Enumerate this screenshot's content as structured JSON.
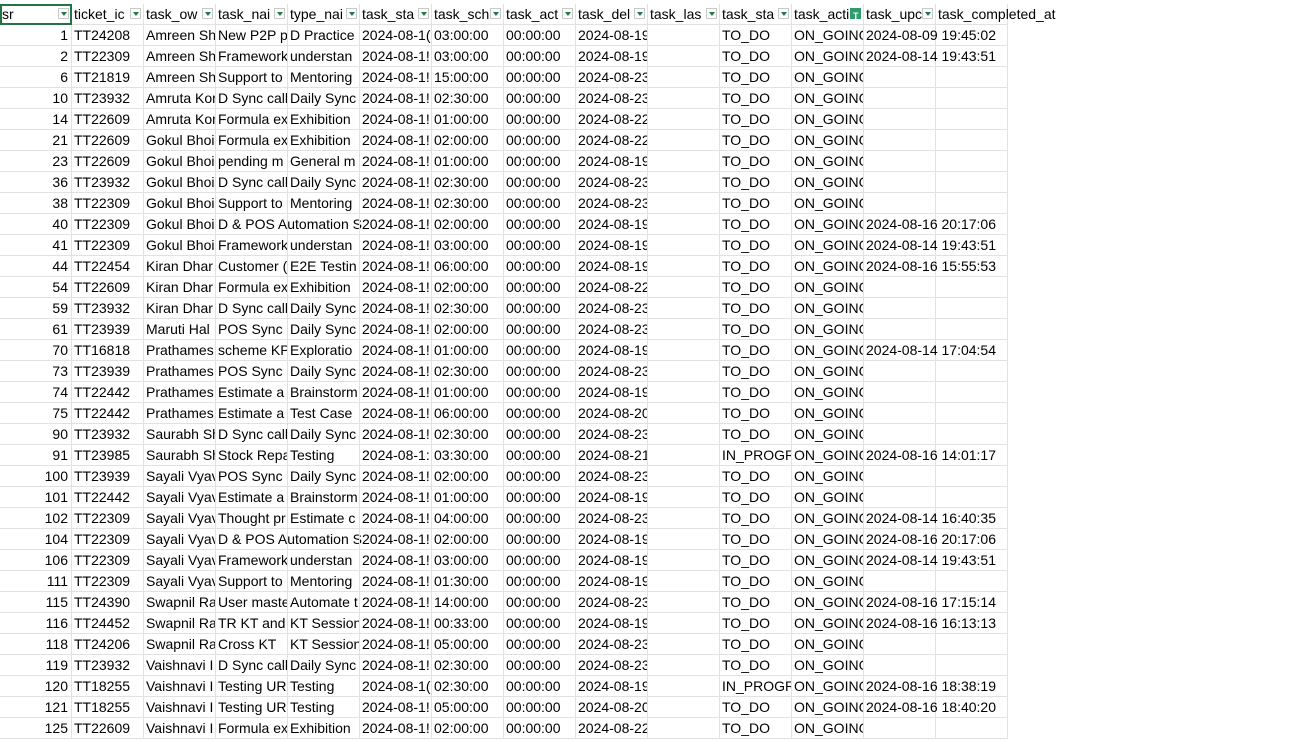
{
  "headers": [
    "sr",
    "ticket_id",
    "task_owner",
    "task_name",
    "type_name",
    "task_start",
    "task_sch",
    "task_act",
    "task_deadline",
    "task_last",
    "task_status",
    "task_activity",
    "task_updated",
    "task_completed_at"
  ],
  "header_display": [
    "sr",
    "ticket_ic",
    "task_ow",
    "task_nai",
    "type_nai",
    "task_sta",
    "task_sch",
    "task_act",
    "task_del",
    "task_las",
    "task_sta",
    "task_acti",
    "task_upc",
    "task_completed_at"
  ],
  "rows": [
    [
      "1",
      "TT24208",
      "Amreen Sh",
      "New P2P p",
      "D Practice",
      "2024-08-1(",
      "03:00:00",
      "00:00:00",
      "2024-08-19",
      "",
      "TO_DO",
      "ON_GOING",
      "2024-08-09 19:45:02",
      ""
    ],
    [
      "2",
      "TT22309",
      "Amreen Sh",
      "Framework",
      "understan",
      "2024-08-1!",
      "03:00:00",
      "00:00:00",
      "2024-08-19",
      "",
      "TO_DO",
      "ON_GOING",
      "2024-08-14 19:43:51",
      ""
    ],
    [
      "6",
      "TT21819",
      "Amreen Sh",
      "Support to",
      "Mentoring",
      "2024-08-1!",
      "15:00:00",
      "00:00:00",
      "2024-08-23",
      "",
      "TO_DO",
      "ON_GOING",
      "",
      ""
    ],
    [
      "10",
      "TT23932",
      "Amruta Kor",
      "D Sync call",
      "Daily Sync",
      "2024-08-1!",
      "02:30:00",
      "00:00:00",
      "2024-08-23",
      "",
      "TO_DO",
      "ON_GOING",
      "",
      ""
    ],
    [
      "14",
      "TT22609",
      "Amruta Kor",
      "Formula ex",
      "Exhibition",
      "2024-08-1!",
      "01:00:00",
      "00:00:00",
      "2024-08-22",
      "",
      "TO_DO",
      "ON_GOING",
      "",
      ""
    ],
    [
      "21",
      "TT22609",
      "Gokul Bhoi",
      "Formula ex",
      "Exhibition",
      "2024-08-1!",
      "02:00:00",
      "00:00:00",
      "2024-08-22",
      "",
      "TO_DO",
      "ON_GOING",
      "",
      ""
    ],
    [
      "23",
      "TT22609",
      "Gokul Bhoi",
      "pending m",
      "General m",
      "2024-08-1!",
      "01:00:00",
      "00:00:00",
      "2024-08-19",
      "",
      "TO_DO",
      "ON_GOING",
      "",
      ""
    ],
    [
      "36",
      "TT23932",
      "Gokul Bhoi",
      "D Sync call",
      "Daily Sync",
      "2024-08-1!",
      "02:30:00",
      "00:00:00",
      "2024-08-23",
      "",
      "TO_DO",
      "ON_GOING",
      "",
      ""
    ],
    [
      "38",
      "TT22309",
      "Gokul Bhoi",
      "Support to",
      "Mentoring",
      "2024-08-1!",
      "02:30:00",
      "00:00:00",
      "2024-08-23",
      "",
      "TO_DO",
      "ON_GOING",
      "",
      ""
    ],
    [
      "40",
      "TT22309",
      "Gokul Bhoi",
      "D & POS Automation S",
      "",
      "2024-08-1!",
      "02:00:00",
      "00:00:00",
      "2024-08-19",
      "",
      "TO_DO",
      "ON_GOING",
      "2024-08-16 20:17:06",
      ""
    ],
    [
      "41",
      "TT22309",
      "Gokul Bhoi",
      "Framework",
      "understan",
      "2024-08-1!",
      "03:00:00",
      "00:00:00",
      "2024-08-19",
      "",
      "TO_DO",
      "ON_GOING",
      "2024-08-14 19:43:51",
      ""
    ],
    [
      "44",
      "TT22454",
      "Kiran Dhar",
      "Customer (",
      "E2E Testin",
      "2024-08-1!",
      "06:00:00",
      "00:00:00",
      "2024-08-19",
      "",
      "TO_DO",
      "ON_GOING",
      "2024-08-16 15:55:53",
      ""
    ],
    [
      "54",
      "TT22609",
      "Kiran Dhar",
      "Formula ex",
      "Exhibition",
      "2024-08-1!",
      "02:00:00",
      "00:00:00",
      "2024-08-22",
      "",
      "TO_DO",
      "ON_GOING",
      "",
      ""
    ],
    [
      "59",
      "TT23932",
      "Kiran Dhar",
      "D Sync call",
      "Daily Sync",
      "2024-08-1!",
      "02:30:00",
      "00:00:00",
      "2024-08-23",
      "",
      "TO_DO",
      "ON_GOING",
      "",
      ""
    ],
    [
      "61",
      "TT23939",
      "Maruti Hal",
      "POS Sync C",
      "Daily Sync",
      "2024-08-1!",
      "02:00:00",
      "00:00:00",
      "2024-08-23",
      "",
      "TO_DO",
      "ON_GOING",
      "",
      ""
    ],
    [
      "70",
      "TT16818",
      "Prathames",
      "scheme KP",
      "Exploratio",
      "2024-08-1!",
      "01:00:00",
      "00:00:00",
      "2024-08-19",
      "",
      "TO_DO",
      "ON_GOING",
      "2024-08-14 17:04:54",
      ""
    ],
    [
      "73",
      "TT23939",
      "Prathames",
      "POS Sync C",
      "Daily Sync",
      "2024-08-1!",
      "02:30:00",
      "00:00:00",
      "2024-08-23",
      "",
      "TO_DO",
      "ON_GOING",
      "",
      ""
    ],
    [
      "74",
      "TT22442",
      "Prathames",
      "Estimate a",
      "Brainstorm",
      "2024-08-1!",
      "01:00:00",
      "00:00:00",
      "2024-08-19",
      "",
      "TO_DO",
      "ON_GOING",
      "",
      ""
    ],
    [
      "75",
      "TT22442",
      "Prathames",
      "Estimate a",
      "Test Case",
      "2024-08-1!",
      "06:00:00",
      "00:00:00",
      "2024-08-20",
      "",
      "TO_DO",
      "ON_GOING",
      "",
      ""
    ],
    [
      "90",
      "TT23932",
      "Saurabh Sh",
      "D Sync call",
      "Daily Sync",
      "2024-08-1!",
      "02:30:00",
      "00:00:00",
      "2024-08-23",
      "",
      "TO_DO",
      "ON_GOING",
      "",
      ""
    ],
    [
      "91",
      "TT23985",
      "Saurabh Sh",
      "Stock Repa",
      "Testing",
      "2024-08-1:",
      "03:30:00",
      "00:00:00",
      "2024-08-21",
      "",
      "IN_PROGR",
      "ON_GOING",
      "2024-08-16 14:01:17",
      ""
    ],
    [
      "100",
      "TT23939",
      "Sayali Vyav",
      "POS Sync C",
      "Daily Sync",
      "2024-08-1!",
      "02:00:00",
      "00:00:00",
      "2024-08-23",
      "",
      "TO_DO",
      "ON_GOING",
      "",
      ""
    ],
    [
      "101",
      "TT22442",
      "Sayali Vyav",
      "Estimate a",
      "Brainstorm",
      "2024-08-1!",
      "01:00:00",
      "00:00:00",
      "2024-08-19",
      "",
      "TO_DO",
      "ON_GOING",
      "",
      ""
    ],
    [
      "102",
      "TT22309",
      "Sayali Vyav",
      "Thought pr",
      "Estimate c",
      "2024-08-1!",
      "04:00:00",
      "00:00:00",
      "2024-08-23",
      "",
      "TO_DO",
      "ON_GOING",
      "2024-08-14 16:40:35",
      ""
    ],
    [
      "104",
      "TT22309",
      "Sayali Vyav",
      "D & POS Automation S",
      "",
      "2024-08-1!",
      "02:00:00",
      "00:00:00",
      "2024-08-19",
      "",
      "TO_DO",
      "ON_GOING",
      "2024-08-16 20:17:06",
      ""
    ],
    [
      "106",
      "TT22309",
      "Sayali Vyav",
      "Framework",
      "understan",
      "2024-08-1!",
      "03:00:00",
      "00:00:00",
      "2024-08-19",
      "",
      "TO_DO",
      "ON_GOING",
      "2024-08-14 19:43:51",
      ""
    ],
    [
      "111",
      "TT22309",
      "Sayali Vyav",
      "Support to",
      "Mentoring",
      "2024-08-1!",
      "01:30:00",
      "00:00:00",
      "2024-08-19",
      "",
      "TO_DO",
      "ON_GOING",
      "",
      ""
    ],
    [
      "115",
      "TT24390",
      "Swapnil Ra",
      "User maste",
      "Automate t",
      "2024-08-1!",
      "14:00:00",
      "00:00:00",
      "2024-08-23",
      "",
      "TO_DO",
      "ON_GOING",
      "2024-08-16 17:15:14",
      ""
    ],
    [
      "116",
      "TT24452",
      "Swapnil Ra",
      "TR KT and",
      "KT Session",
      "2024-08-1!",
      "00:33:00",
      "00:00:00",
      "2024-08-19",
      "",
      "TO_DO",
      "ON_GOING",
      "2024-08-16 16:13:13",
      ""
    ],
    [
      "118",
      "TT24206",
      "Swapnil Ra",
      "Cross KT",
      "KT Session",
      "2024-08-1!",
      "05:00:00",
      "00:00:00",
      "2024-08-23",
      "",
      "TO_DO",
      "ON_GOING",
      "",
      ""
    ],
    [
      "119",
      "TT23932",
      "Vaishnavi I",
      "D Sync call",
      "Daily Sync",
      "2024-08-1!",
      "02:30:00",
      "00:00:00",
      "2024-08-23",
      "",
      "TO_DO",
      "ON_GOING",
      "",
      ""
    ],
    [
      "120",
      "TT18255",
      "Vaishnavi I",
      "Testing UR",
      "Testing",
      "2024-08-1(",
      "02:30:00",
      "00:00:00",
      "2024-08-19",
      "",
      "IN_PROGR",
      "ON_GOING",
      "2024-08-16 18:38:19",
      ""
    ],
    [
      "121",
      "TT18255",
      "Vaishnavi I",
      "Testing UR",
      "Testing",
      "2024-08-1!",
      "05:00:00",
      "00:00:00",
      "2024-08-20",
      "",
      "TO_DO",
      "ON_GOING",
      "2024-08-16 18:40:20",
      ""
    ],
    [
      "125",
      "TT22609",
      "Vaishnavi I",
      "Formula ex",
      "Exhibition",
      "2024-08-1!",
      "02:00:00",
      "00:00:00",
      "2024-08-22",
      "",
      "TO_DO",
      "ON_GOING",
      "",
      ""
    ]
  ],
  "colors": {
    "grid": "#e1e1e1",
    "selection": "#217346",
    "filter_active": "#2e9d6b"
  }
}
